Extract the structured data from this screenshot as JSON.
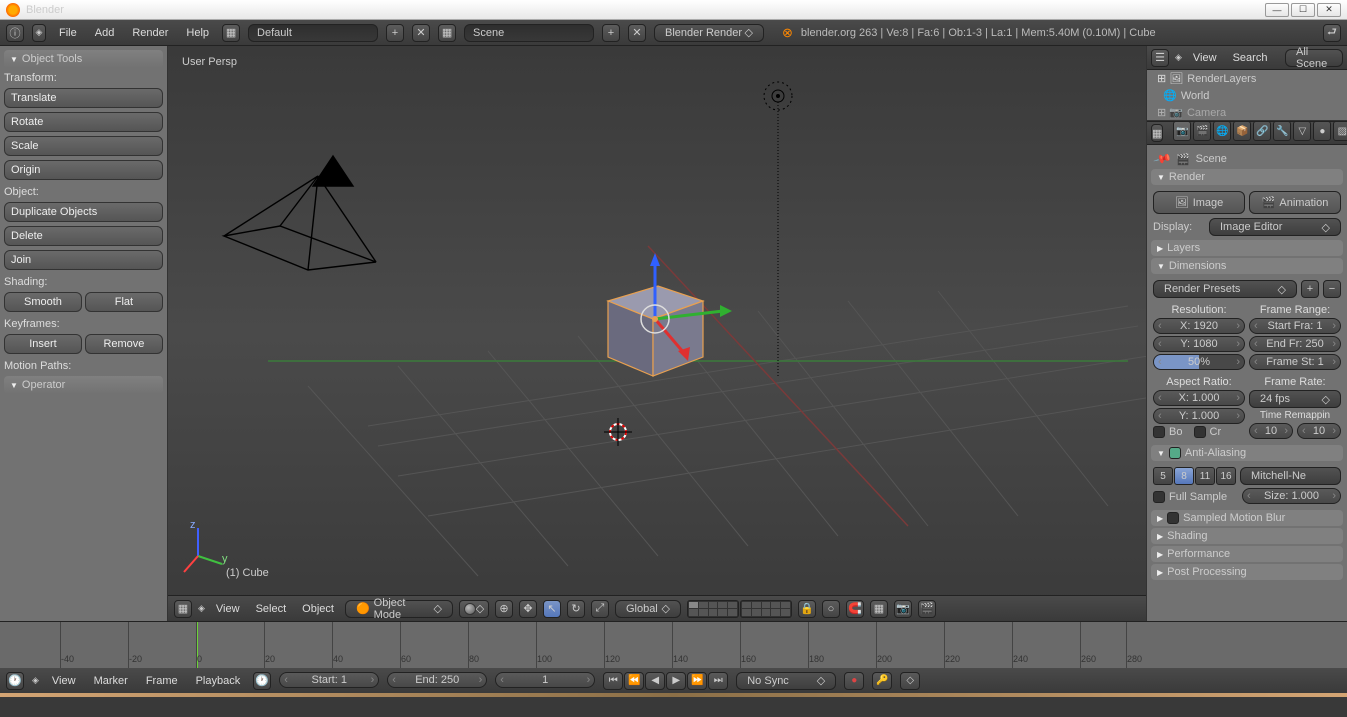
{
  "title": "Blender",
  "topbar": {
    "menus": [
      "File",
      "Add",
      "Render",
      "Help"
    ],
    "layout": "Default",
    "scene": "Scene",
    "engine": "Blender Render",
    "stats": "blender.org 263 | Ve:8 | Fa:6 | Ob:1-3 | La:1 | Mem:5.40M (0.10M) | Cube"
  },
  "tools": {
    "title": "Object Tools",
    "transform": {
      "label": "Transform:",
      "items": [
        "Translate",
        "Rotate",
        "Scale",
        "Origin"
      ]
    },
    "object": {
      "label": "Object:",
      "items": [
        "Duplicate Objects",
        "Delete",
        "Join"
      ]
    },
    "shading": {
      "label": "Shading:",
      "items": [
        "Smooth",
        "Flat"
      ]
    },
    "keyframes": {
      "label": "Keyframes:",
      "items": [
        "Insert",
        "Remove"
      ]
    },
    "motionpaths": "Motion Paths:",
    "operator": "Operator"
  },
  "viewport": {
    "persp": "User Persp",
    "objname": "(1) Cube",
    "mode": "Object Mode",
    "orient": "Global",
    "menus": [
      "View",
      "Select",
      "Object"
    ]
  },
  "outliner": {
    "menus": [
      "View",
      "Search"
    ],
    "all": "All Scene",
    "items": [
      "RenderLayers",
      "World",
      "Camera"
    ]
  },
  "props": {
    "context": "Scene",
    "render": {
      "title": "Render",
      "image": "Image",
      "animation": "Animation",
      "display_l": "Display:",
      "display_v": "Image Editor"
    },
    "layers": "Layers",
    "dims": {
      "title": "Dimensions",
      "presets": "Render Presets",
      "res_l": "Resolution:",
      "x": "X: 1920",
      "y": "Y: 1080",
      "pct": "50%",
      "range_l": "Frame Range:",
      "start": "Start Fra: 1",
      "end": "End Fr: 250",
      "step": "Frame St: 1",
      "aspect_l": "Aspect Ratio:",
      "ax": "X: 1.000",
      "ay": "Y: 1.000",
      "rate_l": "Frame Rate:",
      "rate": "24 fps",
      "remap": "Time Remappin",
      "r1": "10",
      "r2": "10",
      "bo": "Bo",
      "cr": "Cr"
    },
    "aa": {
      "title": "Anti-Aliasing",
      "samples": [
        "5",
        "8",
        "11",
        "16"
      ],
      "filter": "Mitchell-Ne",
      "full": "Full Sample",
      "size": "Size: 1.000"
    },
    "blur": "Sampled Motion Blur",
    "shading": "Shading",
    "perf": "Performance",
    "post": "Post Processing"
  },
  "timeline": {
    "menus": [
      "View",
      "Marker",
      "Frame",
      "Playback"
    ],
    "start": "Start: 1",
    "end": "End: 250",
    "current": "1",
    "sync": "No Sync"
  }
}
